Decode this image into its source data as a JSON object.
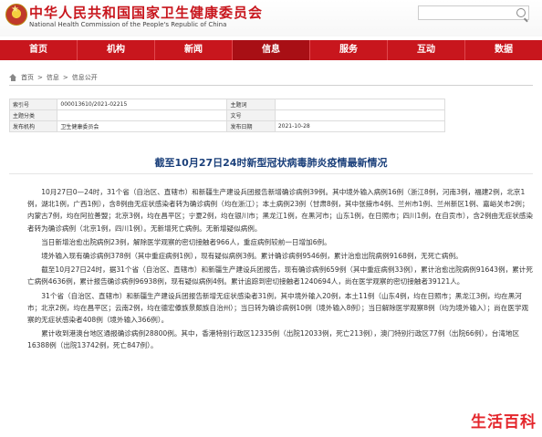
{
  "header": {
    "title": "中华人民共和国国家卫生健康委员会",
    "subtitle": "National Health Commission of the People's Republic of China",
    "search_placeholder": ""
  },
  "nav": [
    "首页",
    "机构",
    "新闻",
    "信息",
    "服务",
    "互动",
    "数据"
  ],
  "breadcrumb": [
    "首页",
    "信息",
    "信息公开"
  ],
  "meta": {
    "index_label": "索引号",
    "index_value": "000013610/2021-02215",
    "sponsor_label": "主题词",
    "sponsor_value": "",
    "topic_label": "主题分类",
    "topic_value": "",
    "docno_label": "文号",
    "docno_value": "",
    "org_label": "发布机构",
    "org_value": "卫生健康委员会",
    "date_label": "发布日期",
    "date_value": "2021-10-28"
  },
  "article": {
    "title": "截至10月27日24时新型冠状病毒肺炎疫情最新情况",
    "paragraphs": [
      "10月27日0—24时，31个省（自治区、直辖市）和新疆生产建设兵团报告新增确诊病例39例。其中境外输入病例16例（浙江8例，河南3例，福建2例，北京1例，湖北1例，广西1例），含8例由无症状感染者转为确诊病例（均在浙江）；本土病例23例（甘肃8例，其中张掖市4例、兰州市1例、兰州新区1例、嘉峪关市2例；内蒙古7例，均在阿拉善盟；北京3例，均在昌平区；宁夏2例，均在银川市；黑龙江1例，在黑河市；山东1例，在日照市；四川1例，在自贡市），含2例由无症状感染者转为确诊病例（北京1例，四川1例）。无新增死亡病例。无新增疑似病例。",
      "当日新增治愈出院病例23例，解除医学观察的密切接触者966人，重症病例较前一日增加6例。",
      "境外输入现有确诊病例378例（其中重症病例1例），现有疑似病例3例。累计确诊病例9546例，累计治愈出院病例9168例，无死亡病例。",
      "截至10月27日24时，据31个省（自治区、直辖市）和新疆生产建设兵团报告，现有确诊病例659例（其中重症病例33例），累计治愈出院病例91643例，累计死亡病例4636例，累计报告确诊病例96938例，现有疑似病例4例。累计追踪到密切接触者1240694人，尚在医学观察的密切接触者39121人。",
      "31个省（自治区、直辖市）和新疆生产建设兵团报告新增无症状感染者31例，其中境外输入20例，本土11例（山东4例，均在日照市；黑龙江3例，均在黑河市；北京2例，均在昌平区；云南2例，均在德宏傣族景颇族自治州）；当日转为确诊病例10例（境外输入8例）；当日解除医学观察8例（均为境外输入）；尚在医学观察的无症状感染者408例（境外输入366例）。",
      "累计收到港澳台地区通报确诊病例28800例。其中，香港特别行政区12335例（出院12033例，死亡213例），澳门特别行政区77例（出院66例），台湾地区16388例（出院13742例，死亡847例）。"
    ]
  },
  "watermark": "生活百科"
}
